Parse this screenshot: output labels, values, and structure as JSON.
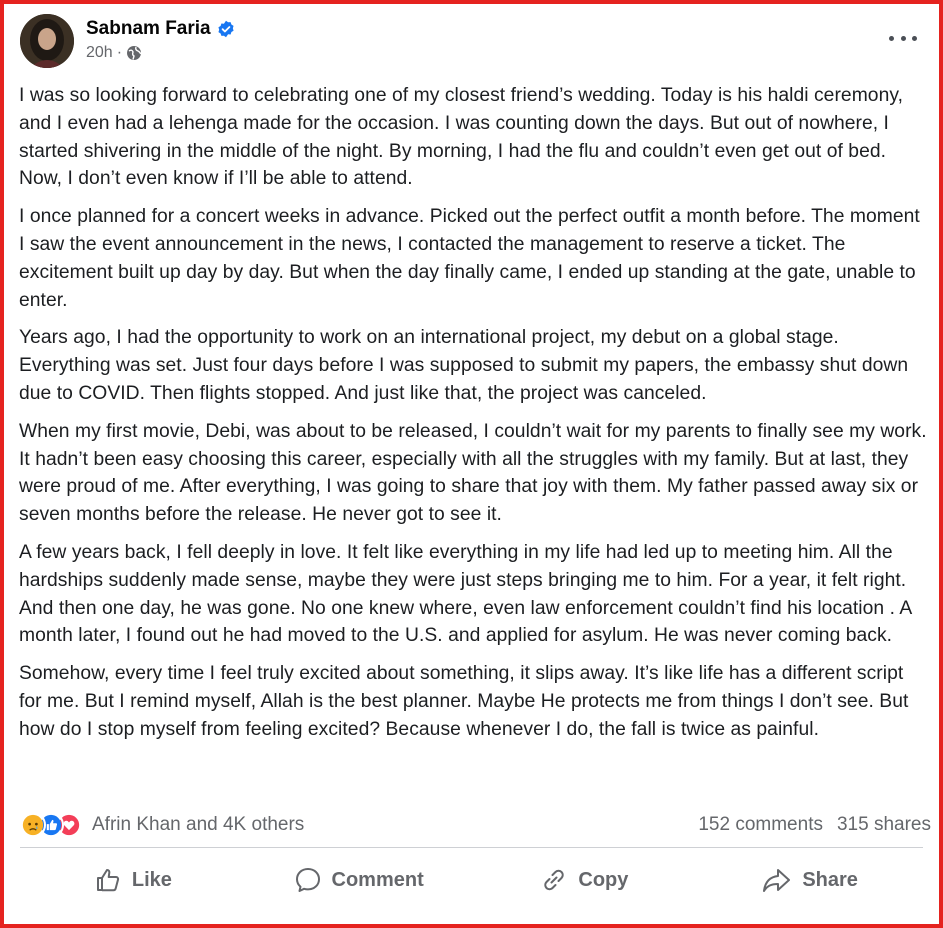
{
  "post": {
    "author": "Sabnam Faria",
    "time": "20h",
    "separator": "·",
    "paragraphs": [
      "I was so looking forward to celebrating one of my closest friend’s wedding. Today is his haldi ceremony, and I even had a lehenga made for the occasion. I was counting down the days. But out of nowhere, I started shivering in the middle of the night. By morning, I had the flu and couldn’t even get out of bed. Now, I don’t even know if I’ll be able to attend.",
      "I once planned for a concert weeks in advance. Picked out the perfect outfit a month before. The moment I saw the event announcement in the news, I contacted the management to reserve a ticket. The excitement built up day by day. But when the day finally came, I ended up standing at the gate, unable to enter.",
      "Years ago, I had the opportunity to work on an international project, my debut on a global stage. Everything was set. Just four days before I was supposed to submit my papers, the embassy shut down due to COVID. Then flights stopped. And just like that, the project was canceled.",
      "When my first movie, Debi, was about to be released, I couldn’t wait for my parents to finally see my work. It hadn’t been easy choosing this career, especially with all the struggles with my family. But at last, they were proud of me. After everything, I was going to share that joy with them. My father passed away six or seven months before the release. He never got to see it.",
      "A few years back, I fell deeply in love. It felt like everything in my life had led up to meeting him. All the hardships suddenly made sense, maybe they were just steps bringing me to him. For a year, it felt right. And then one day, he was gone. No one knew where, even law enforcement couldn’t find his location . A month later, I found out he had moved to the U.S. and applied for asylum. He was never coming back.",
      "Somehow, every time I feel truly excited about something, it slips away. It’s like life has a different script for me. But I remind myself, Allah is the best planner. Maybe He protects me from things I don’t see. But how do I stop myself from feeling excited? Because whenever I do, the fall is twice as painful."
    ]
  },
  "stats": {
    "reactors": "Afrin Khan and 4K others",
    "comments": "152 comments",
    "shares": "315 shares",
    "reaction_icons": [
      "sad-icon",
      "like-icon",
      "love-icon"
    ]
  },
  "actions": {
    "like": "Like",
    "comment": "Comment",
    "copy": "Copy",
    "share": "Share"
  },
  "colors": {
    "frame_border": "#e5231f",
    "verified": "#1877f2",
    "secondary_text": "#65676b"
  }
}
